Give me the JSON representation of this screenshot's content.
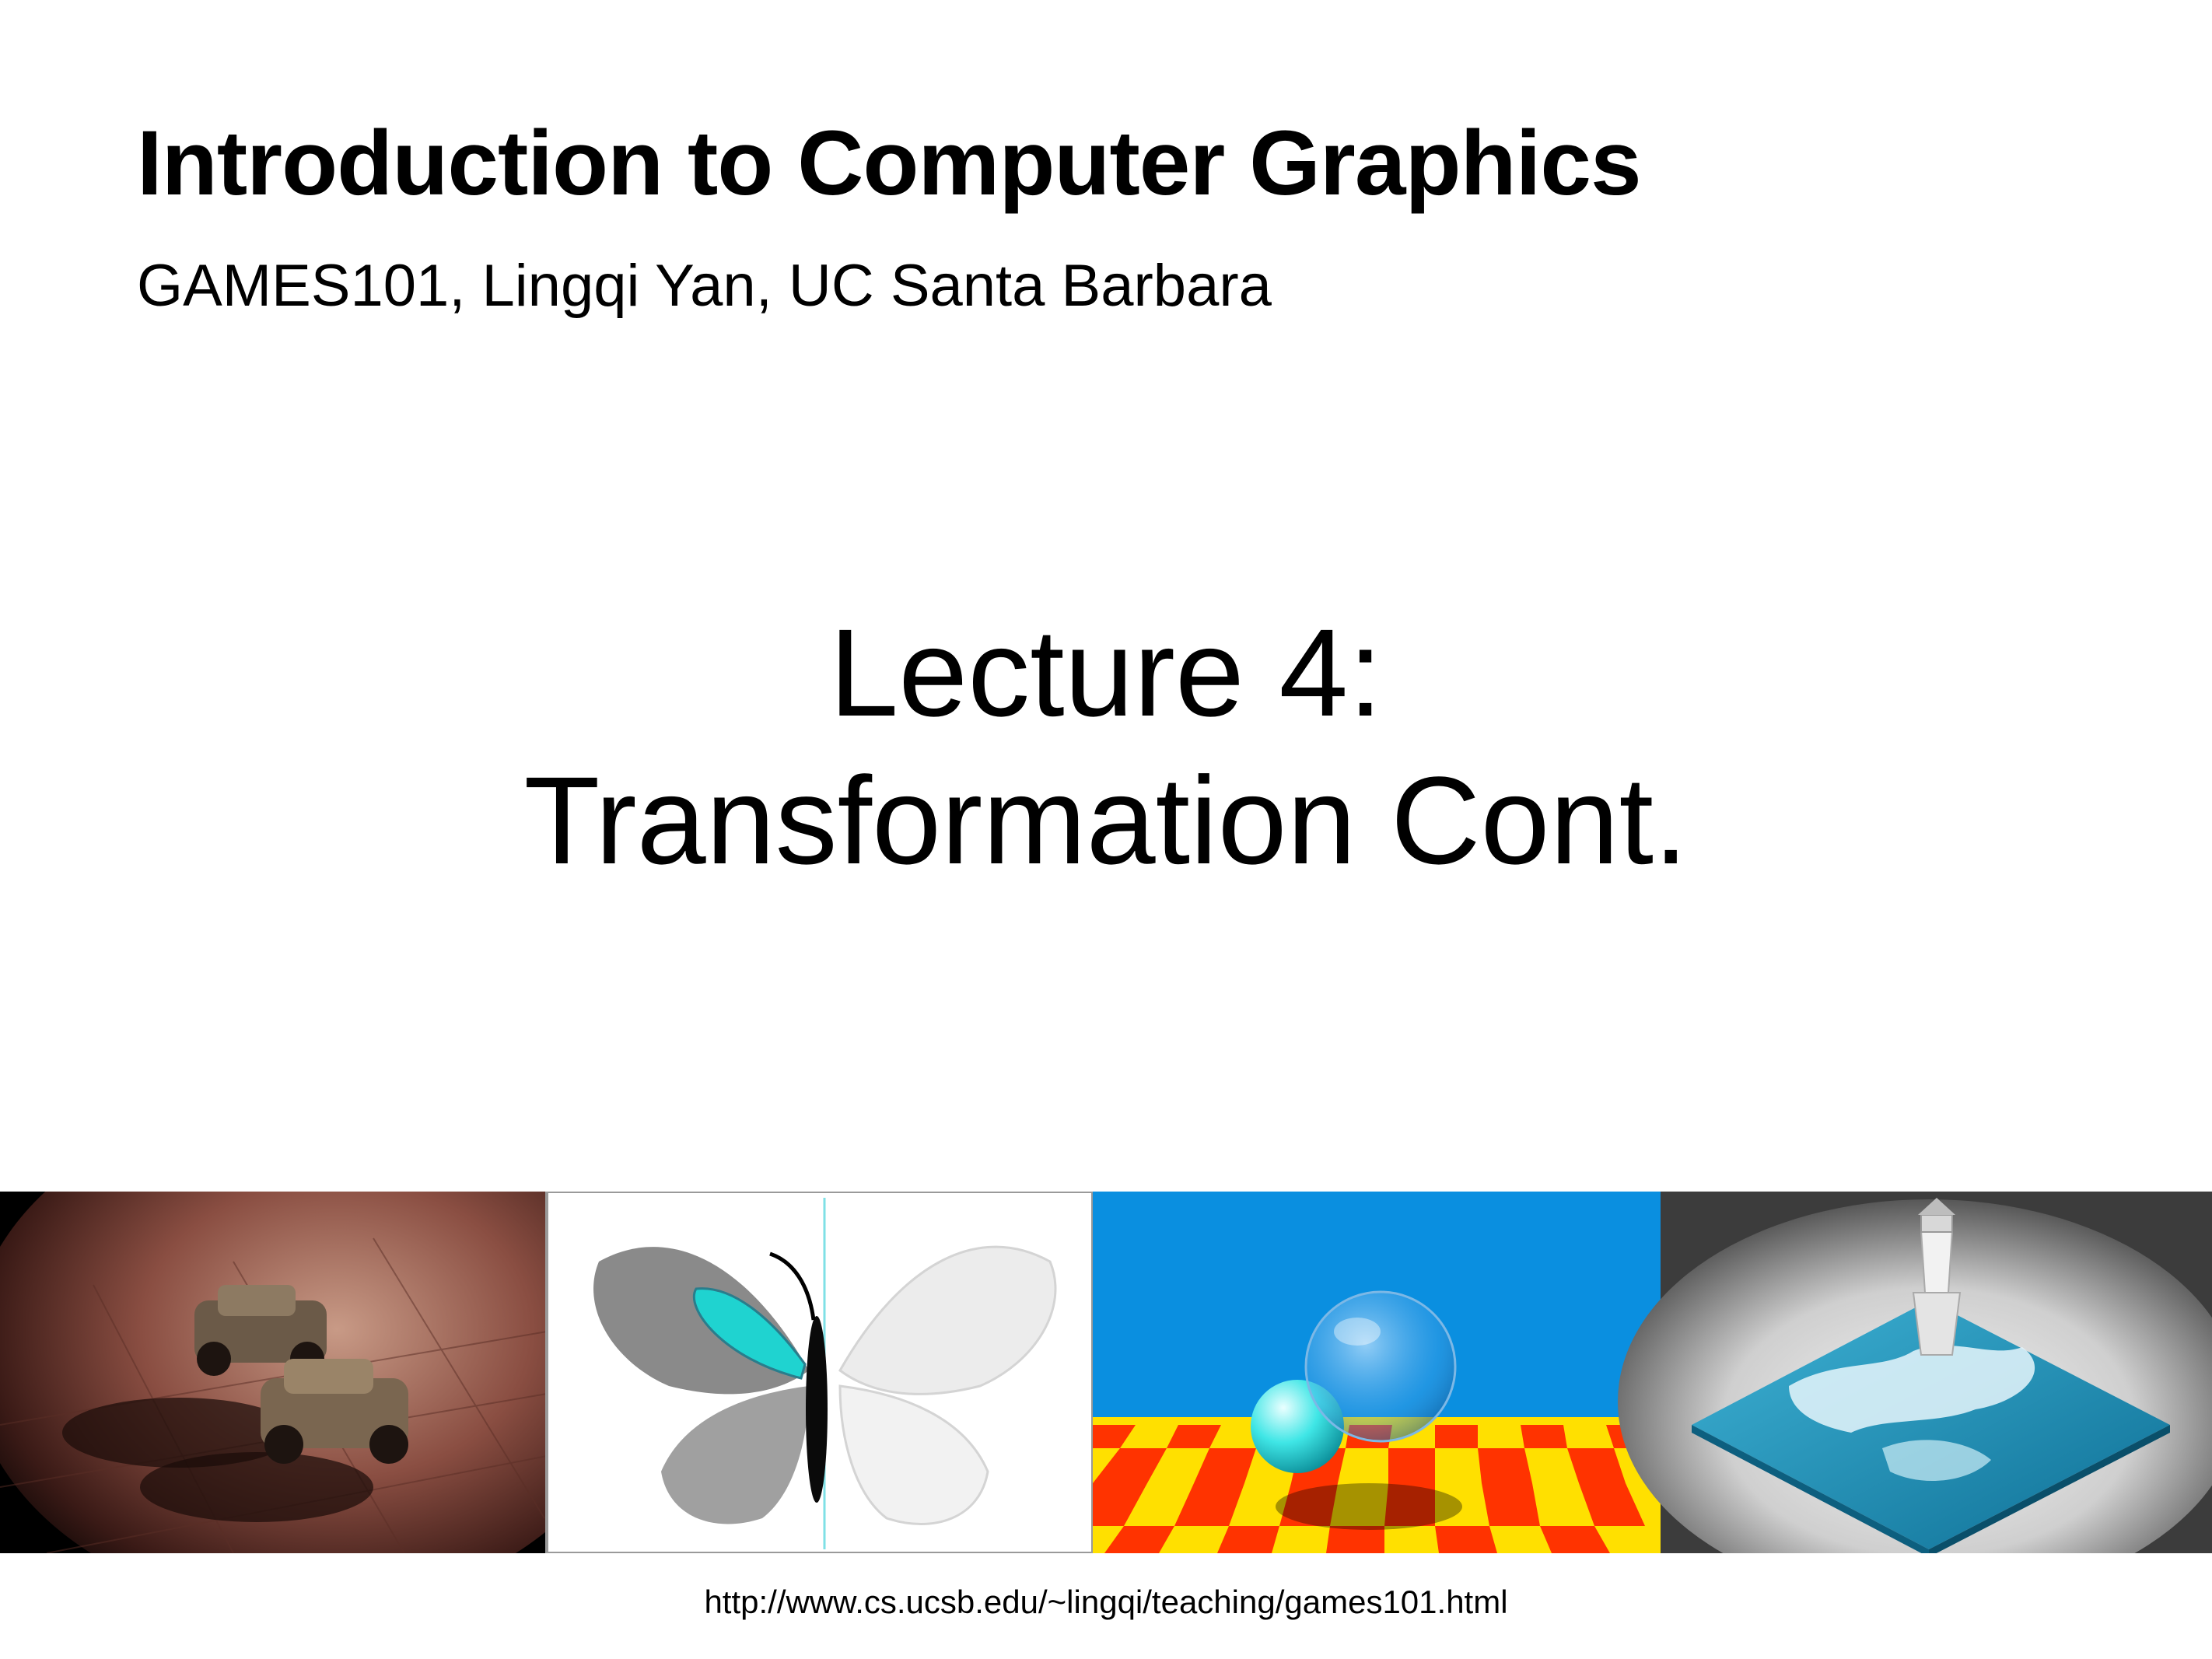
{
  "slide": {
    "course_title": "Introduction to Computer Graphics",
    "course_subtitle": "GAMES101, Lingqi Yan, UC Santa Barbara",
    "lecture_line1": "Lecture 4:",
    "lecture_line2": "Transformation Cont.",
    "url": "http://www.cs.ucsb.edu/~lingqi/teaching/games101.html"
  },
  "image_strip": {
    "panels": [
      {
        "depicts": "toy-cars-render-image"
      },
      {
        "depicts": "butterfly-vector-image"
      },
      {
        "depicts": "ray-traced-spheres-image"
      },
      {
        "depicts": "lighthouse-water-sim-image"
      }
    ]
  },
  "colors": {
    "sky_blue": "#0a8fe0",
    "checker_red": "#ff3300",
    "checker_yellow": "#ffe000",
    "water_blue": "#1d8fb8",
    "floor_brown": "#7a4438",
    "butterfly_cyan": "#1fd3d0"
  }
}
